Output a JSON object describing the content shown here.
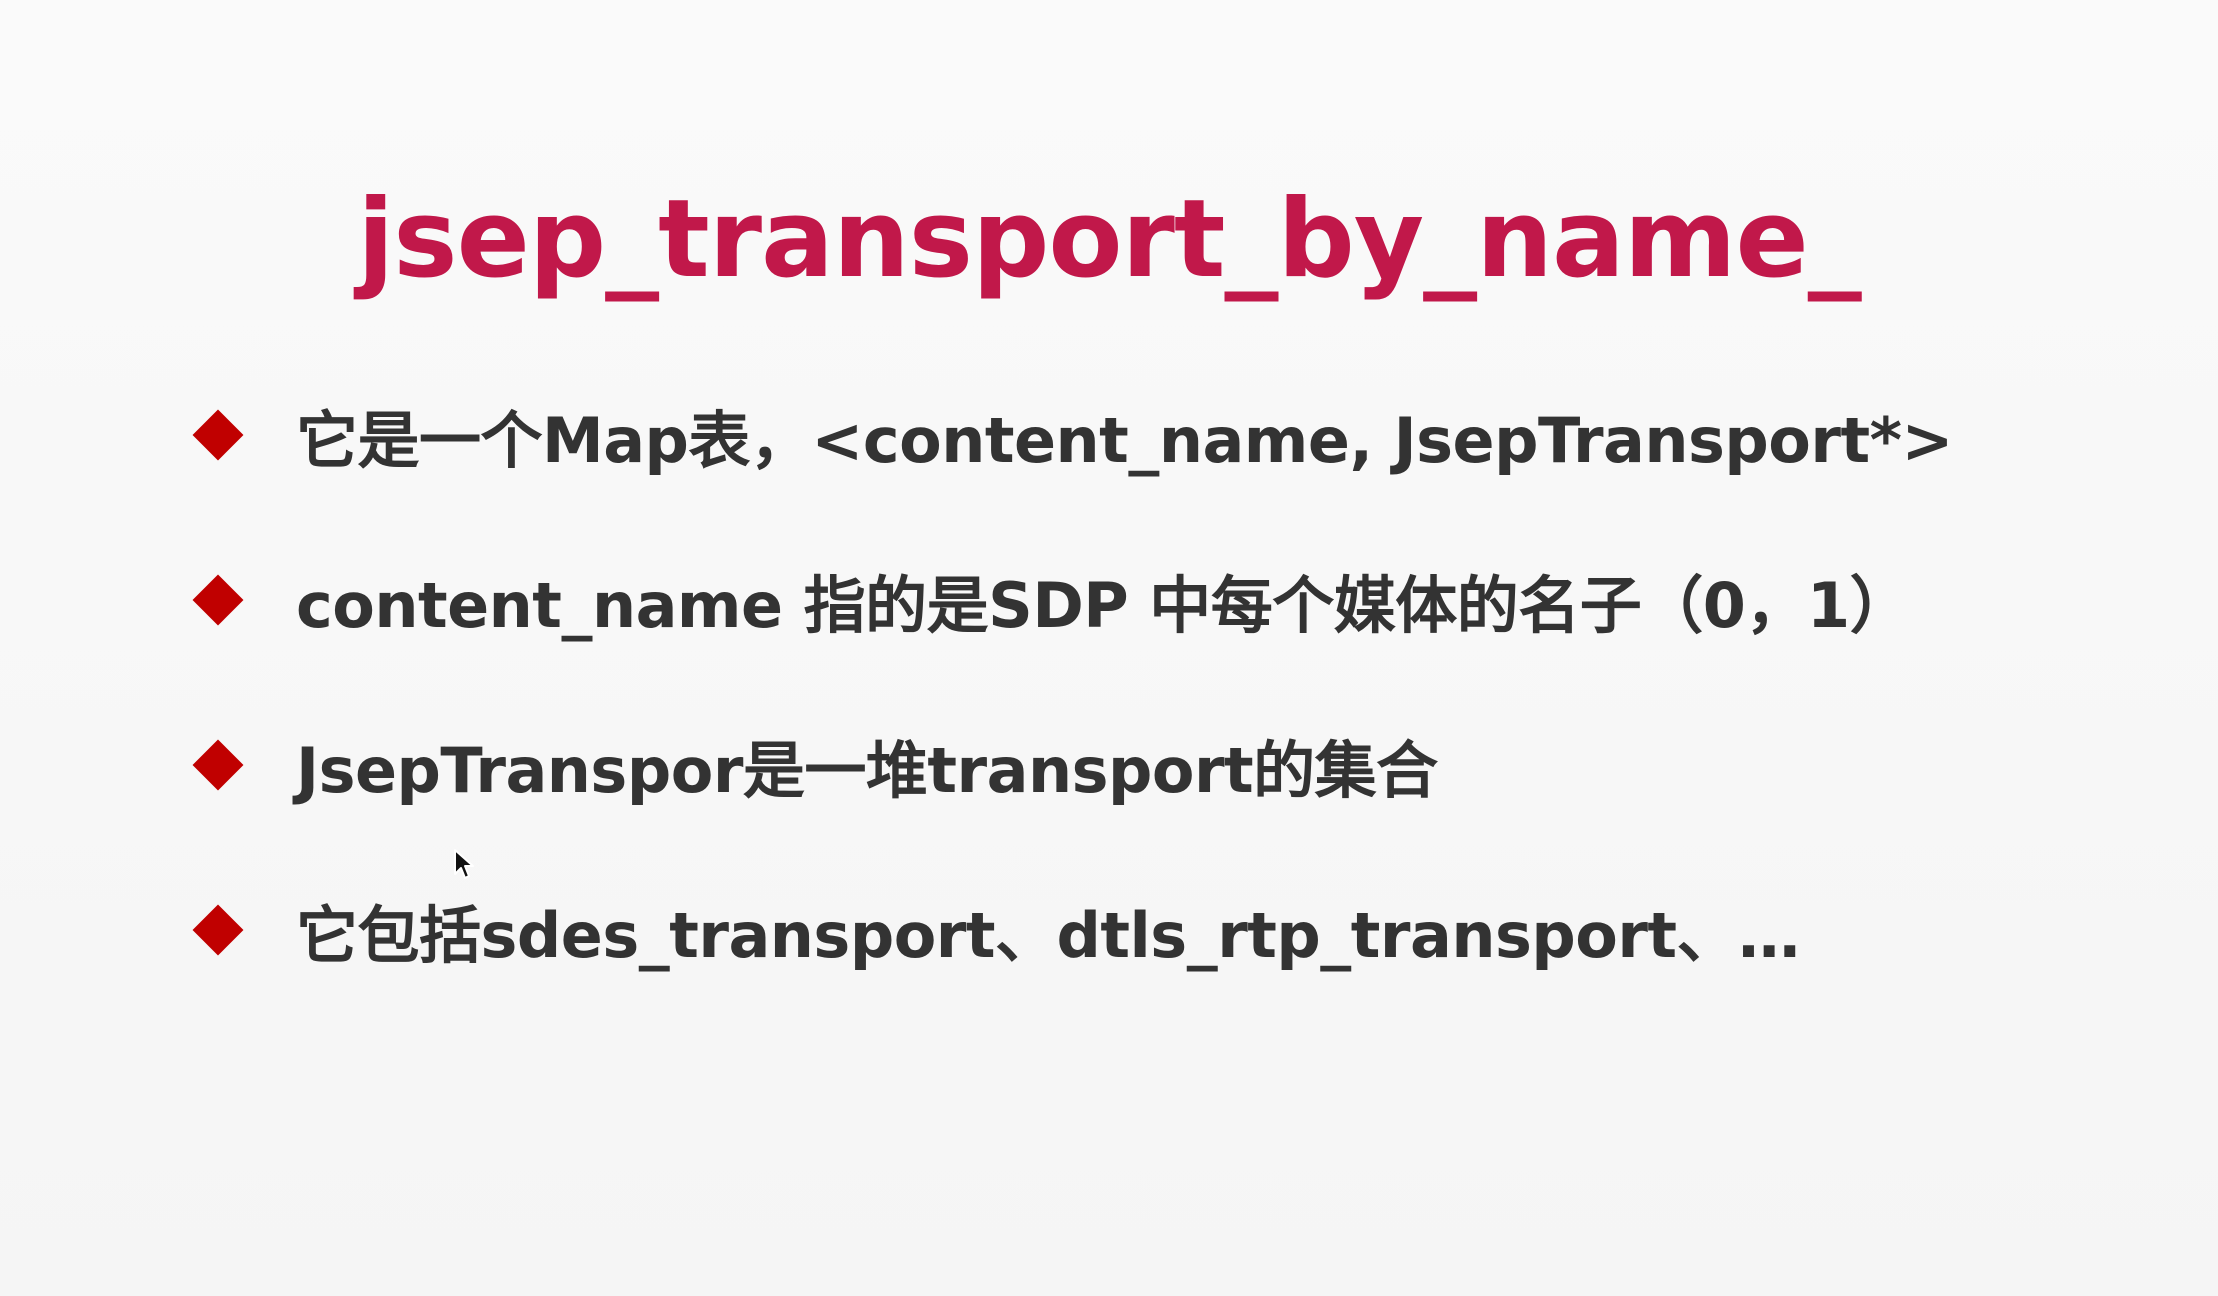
{
  "slide": {
    "title": "jsep_transport_by_name_",
    "bullets": [
      "它是一个Map表，<content_name, JsepTransport*>",
      "content_name 指的是SDP 中每个媒体的名子（0，1）",
      "JsepTranspor是一堆transport的集合",
      "它包括sdes_transport、dtls_rtp_transport、…"
    ]
  },
  "colors": {
    "title": "#c1184a",
    "bullet_marker": "#c00000",
    "text": "#333333",
    "background": "#f8f8f8"
  },
  "icons": {
    "bullet_marker": "diamond-icon",
    "pointer": "mouse-pointer-icon"
  }
}
